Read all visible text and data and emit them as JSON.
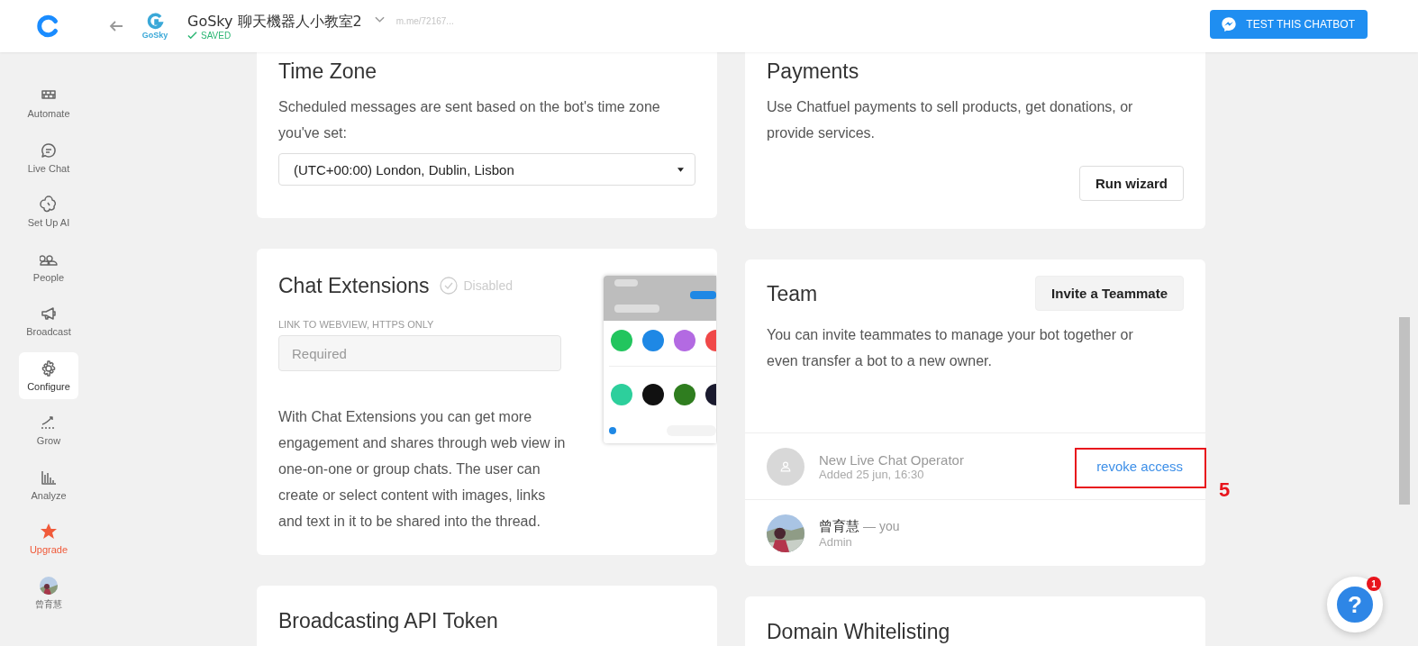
{
  "header": {
    "logo_text": "GoSky",
    "title": "GoSky 聊天機器人小教室2",
    "saved_label": "SAVED",
    "saved": true,
    "link": "m.me/72167...",
    "test_button": "TEST THIS CHATBOT"
  },
  "sidebar": {
    "items": [
      {
        "label": "Automate",
        "selected": false,
        "kind": "nav"
      },
      {
        "label": "Live Chat",
        "selected": false,
        "kind": "nav"
      },
      {
        "label": "Set Up AI",
        "selected": false,
        "kind": "nav"
      },
      {
        "label": "People",
        "selected": false,
        "kind": "nav"
      },
      {
        "label": "Broadcast",
        "selected": false,
        "kind": "nav"
      },
      {
        "label": "Configure",
        "selected": true,
        "kind": "nav"
      },
      {
        "label": "Grow",
        "selected": false,
        "kind": "nav"
      },
      {
        "label": "Analyze",
        "selected": false,
        "kind": "nav"
      },
      {
        "label": "Upgrade",
        "selected": false,
        "kind": "upgrade"
      },
      {
        "label": "曾育慧",
        "selected": false,
        "kind": "profile"
      }
    ]
  },
  "time_zone": {
    "title": "Time Zone",
    "description": "Scheduled messages are sent based on the bot's time zone you've set:",
    "select_value": "(UTC+00:00) London, Dublin, Lisbon"
  },
  "chat_extensions": {
    "title": "Chat Extensions",
    "enabled": false,
    "status": "Disabled",
    "field_label": "LINK TO WEBVIEW, HTTPS ONLY",
    "placeholder": "Required",
    "description": "With Chat Extensions you can get more engagement and shares through web view in one-on-one or group chats. The user can create or select content with images, links and text in it to be shared into the thread."
  },
  "broadcasting": {
    "title": "Broadcasting API Token"
  },
  "payments": {
    "title": "Payments",
    "description": "Use Chatfuel payments to sell products, get donations, or provide services.",
    "button": "Run wizard"
  },
  "team": {
    "title": "Team",
    "invite_button": "Invite a Teammate",
    "description": "You can invite teammates to manage your bot together or even transfer a bot to a new owner.",
    "members": [
      {
        "kind": "placeholder",
        "name": "New Live Chat Operator",
        "subtitle": "Added 25 jun, 16:30",
        "action": "revoke access",
        "annotation": "5"
      },
      {
        "name": "曾育慧",
        "suffix": "— you",
        "subtitle": "Admin"
      }
    ]
  },
  "domain": {
    "title": "Domain Whitelisting"
  },
  "help": {
    "glyph": "?",
    "badge": "1"
  }
}
